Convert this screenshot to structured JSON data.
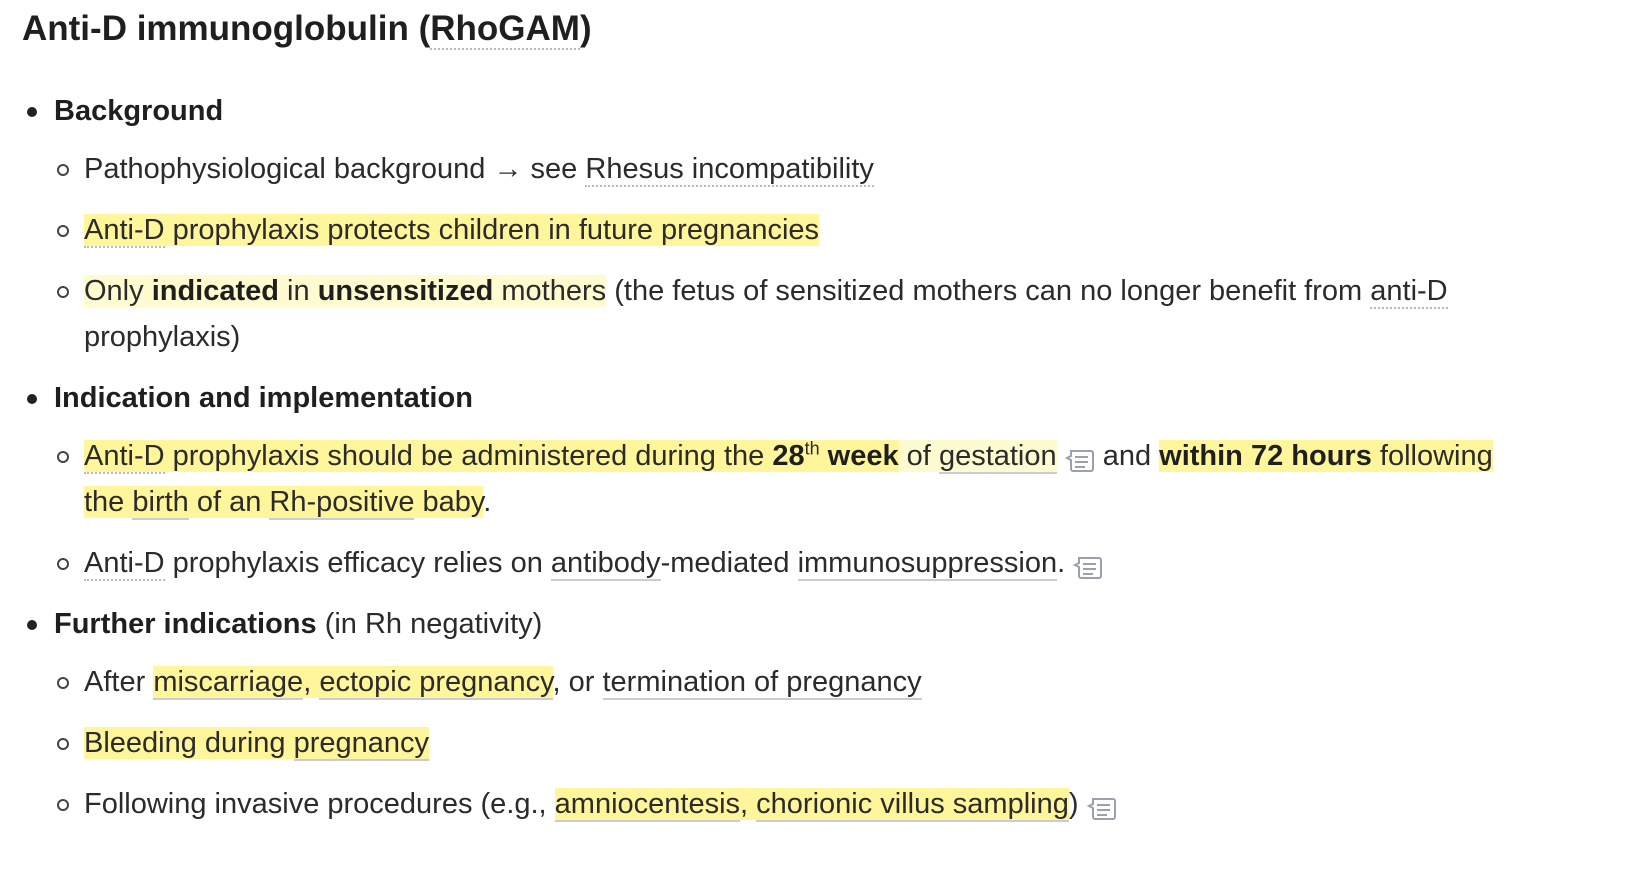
{
  "title": {
    "prefix": "Anti-D immunoglobulin (",
    "link": "RhoGAM",
    "suffix": ")"
  },
  "sections": [
    {
      "heading": "Background",
      "items": [
        {
          "t1": "Pathophysiological background → see ",
          "link": "Rhesus incompatibility"
        },
        {
          "link": "Anti-D",
          "t1": " prophylaxis protects children in future pregnancies"
        },
        {
          "t1": "Only ",
          "b1": "indicated",
          "t2": " in ",
          "b2": "unsensitized",
          "t3": " mothers",
          "t4": " (the fetus of sensitized mothers can no longer benefit from ",
          "link": "anti-D",
          "t5": " prophylaxis)"
        }
      ]
    },
    {
      "heading": "Indication and implementation",
      "items": [
        {
          "link": "Anti-D",
          "t1": " prophylaxis should be administered during the ",
          "b1": "28",
          "sup": "th",
          "b2": " week",
          "t2": " of ",
          "link2": "gestation",
          "t3": " and ",
          "b3": "within 72 hours",
          "t4": " following",
          "t5": "the ",
          "link3": "birth",
          "t6": " of an ",
          "link4": "Rh-positive",
          "t7": " baby",
          "t8": "."
        },
        {
          "link": "Anti-D",
          "t1": " prophylaxis efficacy relies on ",
          "link2": "antibody",
          "t2": "-mediated ",
          "link3": "immunosuppression",
          "t3": "."
        }
      ]
    },
    {
      "heading": "Further indications",
      "heading_suffix": " (in Rh negativity)",
      "items": [
        {
          "t1": "After ",
          "link1": "miscarriage",
          "t2": ", ",
          "link2": "ectopic pregnancy",
          "t3": ", or ",
          "link3": "termination of pregnancy"
        },
        {
          "t1": "Bleeding during ",
          "link1": "pregnancy"
        },
        {
          "t1": "Following invasive procedures (e.g., ",
          "link1": "amniocentesis",
          "t2": ", ",
          "link2": "chorionic villus sampling",
          "t3": ")"
        }
      ]
    }
  ],
  "colors": {
    "highlight": "#fff59a",
    "highlight_soft": "#fffbd0"
  },
  "icons": [
    "note-icon"
  ]
}
